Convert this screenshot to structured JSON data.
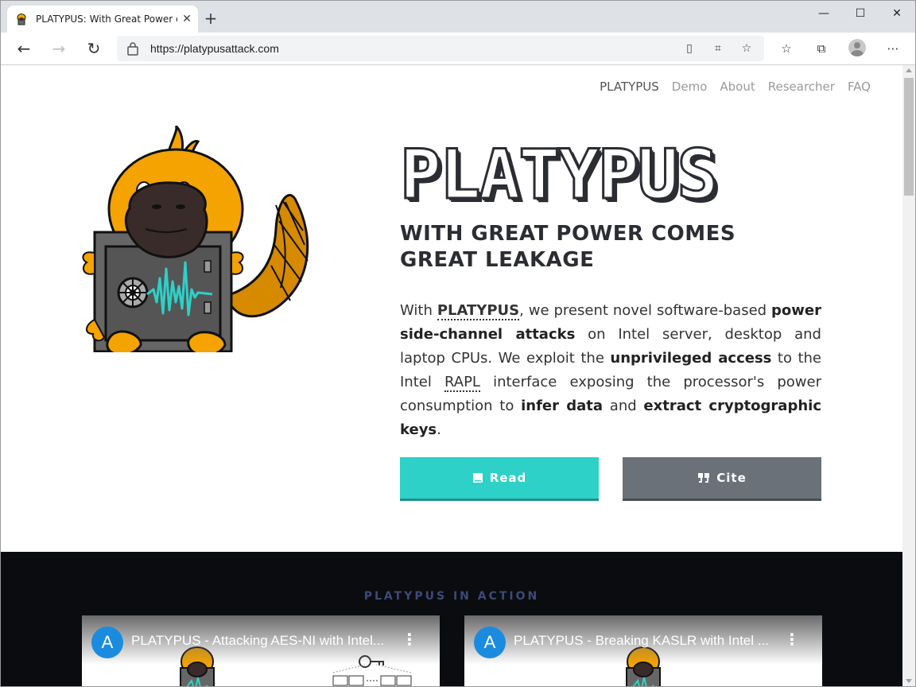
{
  "browser": {
    "tab_title": "PLATYPUS: With Great Power co",
    "tab_close": "✕",
    "new_tab": "+",
    "url": "https://platypusattack.com",
    "window_controls": {
      "minimize": "—",
      "maximize": "☐",
      "close": "✕"
    }
  },
  "site_nav": [
    "PLATYPUS",
    "Demo",
    "About",
    "Researcher",
    "FAQ"
  ],
  "hero": {
    "title": "PLATYPUS",
    "tagline": "WITH GREAT POWER COMES GREAT LEAKAGE",
    "desc": {
      "p1": "With ",
      "platypus": "PLATYPUS",
      "p2": ", we present novel software-based ",
      "b1": "power side-channel attacks",
      "p3": " on Intel server, desktop and laptop CPUs. We exploit the ",
      "b2": "unprivileged access",
      "p4": " to the Intel ",
      "rapl": "RAPL",
      "p5": " interface exposing the processor's power consumption to ",
      "b3": "infer data",
      "p6": " and ",
      "b4": "extract cryptographic keys",
      "p7": "."
    },
    "read_label": "Read",
    "cite_label": "Cite"
  },
  "action_section": {
    "heading": "PLATYPUS IN ACTION",
    "videos": [
      {
        "channel_initial": "A",
        "title": "PLATYPUS - Attacking AES-NI with Intel..."
      },
      {
        "channel_initial": "A",
        "title": "PLATYPUS - Breaking KASLR with Intel ..."
      }
    ]
  },
  "colors": {
    "read_button": "#2dd1c8",
    "cite_button": "#6a7178",
    "dark_bg": "#0b0c10",
    "heading_accent": "#3d4a78",
    "platypus_orange": "#f4a300"
  }
}
